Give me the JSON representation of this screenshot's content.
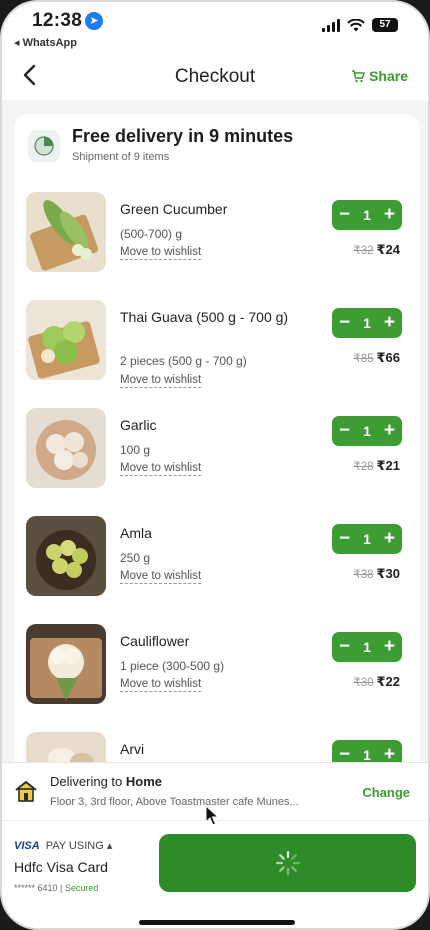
{
  "status_bar": {
    "time": "12:38",
    "back_app": "◂ WhatsApp",
    "battery": "57"
  },
  "header": {
    "title": "Checkout",
    "share_label": "Share"
  },
  "delivery": {
    "title": "Free delivery in 9 minutes",
    "subtitle": "Shipment of 9 items"
  },
  "items": [
    {
      "name": "Green Cucumber",
      "qty": "(500-700) g",
      "wishlist": "Move to wishlist",
      "count": "1",
      "mrp": "₹32",
      "price": "₹24"
    },
    {
      "name": "Thai Guava (500 g - 700 g)",
      "qty": "2 pieces (500 g - 700 g)",
      "wishlist": "Move to wishlist",
      "count": "1",
      "mrp": "₹85",
      "price": "₹66"
    },
    {
      "name": "Garlic",
      "qty": "100 g",
      "wishlist": "Move to wishlist",
      "count": "1",
      "mrp": "₹28",
      "price": "₹21"
    },
    {
      "name": "Amla",
      "qty": "250 g",
      "wishlist": "Move to wishlist",
      "count": "1",
      "mrp": "₹38",
      "price": "₹30"
    },
    {
      "name": "Cauliflower",
      "qty": "1 piece (300-500 g)",
      "wishlist": "Move to wishlist",
      "count": "1",
      "mrp": "₹30",
      "price": "₹22"
    },
    {
      "name": "Arvi",
      "qty": "",
      "wishlist": "",
      "count": "1",
      "mrp": "",
      "price": ""
    }
  ],
  "deliver_to": {
    "label": "Delivering to",
    "place": "Home",
    "address": "Floor 3, 3rd floor, Above Toastmaster cafe Munes...",
    "change_label": "Change"
  },
  "payment": {
    "brand": "VISA",
    "pay_using": "PAY USING ▴",
    "card_name": "Hdfc Visa Card",
    "card_number": "****** 6410",
    "secured": "Secured"
  },
  "colors": {
    "accent_green": "#3e9c35",
    "place_button": "#2e8b2a"
  }
}
